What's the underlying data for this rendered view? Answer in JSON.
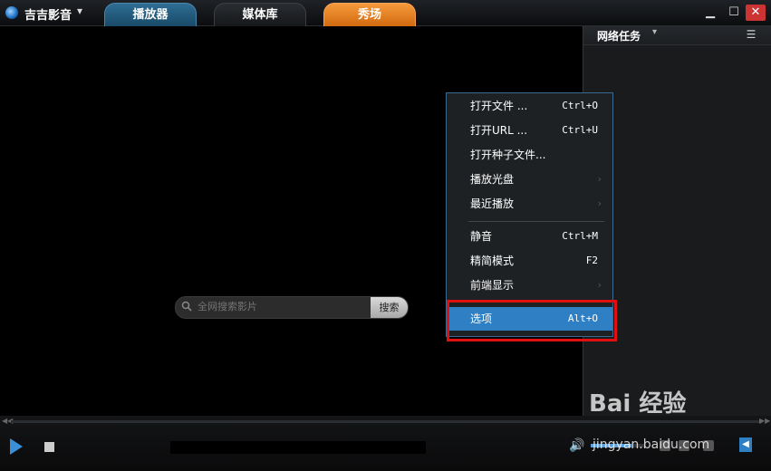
{
  "app": {
    "title": "吉吉影音",
    "caret": "▾"
  },
  "tabs": [
    {
      "label": "播放器"
    },
    {
      "label": "媒体库"
    },
    {
      "label": "秀场"
    }
  ],
  "window_controls": {
    "minimize": "▁",
    "maximize": "☐",
    "close": "✕"
  },
  "side_panel": {
    "title": "网络任务",
    "caret": "▾",
    "menu_icon": "☰"
  },
  "search": {
    "placeholder": "全网搜索影片",
    "button_label": "搜索",
    "icon": "search-icon"
  },
  "context_menu": {
    "items": [
      {
        "label": "打开文件 ...",
        "shortcut": "Ctrl+O",
        "submenu": false
      },
      {
        "label": "打开URL ...",
        "shortcut": "Ctrl+U",
        "submenu": false
      },
      {
        "label": "打开种子文件...",
        "shortcut": "",
        "submenu": false
      },
      {
        "label": "播放光盘",
        "shortcut": "",
        "submenu": true
      },
      {
        "label": "最近播放",
        "shortcut": "",
        "submenu": true
      },
      {
        "label": "静音",
        "shortcut": "Ctrl+M",
        "submenu": false
      },
      {
        "label": "精简模式",
        "shortcut": "F2",
        "submenu": false
      },
      {
        "label": "前端显示",
        "shortcut": "",
        "submenu": true
      },
      {
        "label": "选项",
        "shortcut": "Alt+O",
        "submenu": false,
        "selected": true
      }
    ],
    "submenu_arrow": "›"
  },
  "controls": {
    "play_icon": "play-icon",
    "stop_icon": "stop-icon",
    "volume_icon": "🔊"
  },
  "watermark": {
    "brand": "Bai 经验",
    "url": "jingyan.baidu.com"
  },
  "colors": {
    "accent": "#2f7fc4",
    "tab_show": "#e8832a",
    "highlight_box": "#e01010"
  }
}
